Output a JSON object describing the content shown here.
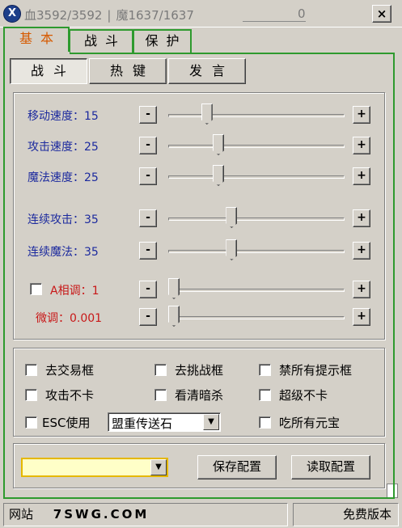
{
  "titlebar": {
    "icon_letter": "X",
    "hp_text": "血3592/3592",
    "sep": "|",
    "mp_text": "魔1637/1637",
    "zero": "0",
    "close": "×"
  },
  "outer_tabs": [
    {
      "label": "基本",
      "active": true
    },
    {
      "label": "战斗",
      "active": false
    },
    {
      "label": "保护",
      "active": false
    }
  ],
  "inner_tabs": [
    {
      "label": "战斗",
      "active": true
    },
    {
      "label": "热键",
      "active": false
    },
    {
      "label": "发言",
      "active": false
    }
  ],
  "sliders": [
    {
      "label": "移动速度：",
      "value": "15",
      "level": 0.2,
      "red": false
    },
    {
      "label": "攻击速度：",
      "value": "25",
      "level": 0.27,
      "red": false
    },
    {
      "label": "魔法速度：",
      "value": "25",
      "level": 0.27,
      "red": false
    },
    {
      "label": "连续攻击：",
      "value": "35",
      "level": 0.35,
      "red": false
    },
    {
      "label": "连续魔法：",
      "value": "35",
      "level": 0.35,
      "red": false
    },
    {
      "label": "A相调：",
      "value": "1",
      "level": 0.0,
      "red": true,
      "checkbox": true
    },
    {
      "label": "微调：",
      "value": "0.001",
      "level": 0.0,
      "red": true
    }
  ],
  "stepper": {
    "minus": "-",
    "plus": "+"
  },
  "options": {
    "trade": "去交易框",
    "challenge": "去挑战框",
    "no_prompts": "禁所有提示框",
    "attack_nolag": "攻击不卡",
    "see_assassin": "看清暗杀",
    "super_nolag": "超级不卡",
    "esc_use": "ESC使用",
    "eat_yuanbao": "吃所有元宝"
  },
  "teleport_select": {
    "value": "盟重传送石",
    "arrow": "▼"
  },
  "config": {
    "combo_value": "",
    "combo_arrow": "▼",
    "save": "保存配置",
    "load": "读取配置"
  },
  "status": {
    "site_label": "网站",
    "site_url": "7SWG.COM",
    "edition": "免费版本"
  },
  "colors": {
    "tab_border": "#2e9a2e",
    "active_tab_text": "#d65a00",
    "label_blue": "#1c2a9e",
    "label_red": "#c81818",
    "config_combo_border": "#e5b800"
  }
}
